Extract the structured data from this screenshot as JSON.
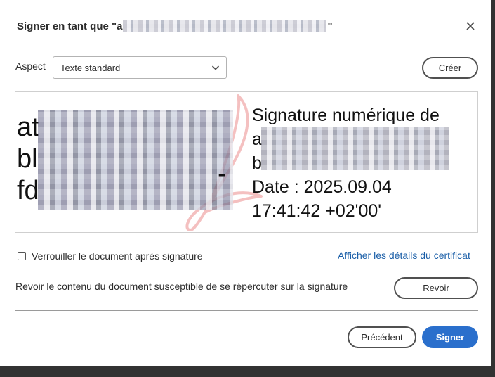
{
  "dialog": {
    "title_prefix": "Signer en tant que \"a",
    "title_suffix": "\"",
    "close_icon": "close-icon"
  },
  "appearance": {
    "label": "Aspect",
    "selected": "Texte standard",
    "create_label": "Créer"
  },
  "preview": {
    "name_lines": [
      "at",
      "bl",
      "fd"
    ],
    "name_line2_suffix": "-",
    "signature_lines": [
      "Signature numérique de",
      "a",
      "b",
      "Date : 2025.09.04",
      "17:41:42 +02'00'"
    ]
  },
  "options": {
    "lock_label": "Verrouiller le document après signature",
    "lock_checked": false,
    "certificate_link": "Afficher les détails du certificat",
    "review_text": "Revoir le contenu du document susceptible de se répercuter sur la signature",
    "review_label": "Revoir"
  },
  "footer": {
    "previous_label": "Précédent",
    "sign_label": "Signer"
  },
  "colors": {
    "primary": "#2a6fcc",
    "link": "#1b5fa8",
    "watermark": "#f4c0c0"
  }
}
